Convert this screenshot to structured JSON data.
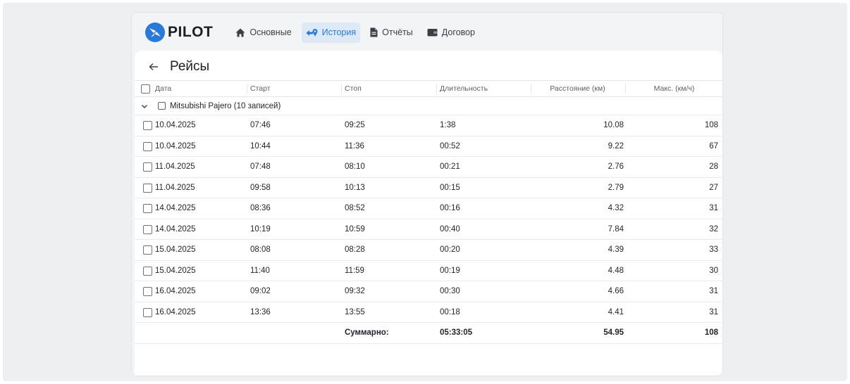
{
  "brand": {
    "name": "PILOT",
    "accent": "#2979d8"
  },
  "nav": [
    {
      "label": "Основные",
      "icon": "home-icon",
      "active": false
    },
    {
      "label": "История",
      "icon": "route-icon",
      "active": true
    },
    {
      "label": "Отчёты",
      "icon": "document-icon",
      "active": false
    },
    {
      "label": "Договор",
      "icon": "wallet-icon",
      "active": false
    }
  ],
  "page": {
    "title": "Рейсы"
  },
  "table": {
    "headers": {
      "date": "Дата",
      "start": "Старт",
      "stop": "Стоп",
      "duration": "Длительность",
      "distance": "Расстояние (км)",
      "max_speed": "Макс. (км/ч)"
    },
    "group": {
      "label": "Mitsubishi Pajero (10 записей)",
      "expanded": true
    },
    "rows": [
      {
        "date": "10.04.2025",
        "start": "07:46",
        "stop": "09:25",
        "duration": "1:38",
        "distance": "10.08",
        "max_speed": "108"
      },
      {
        "date": "10.04.2025",
        "start": "10:44",
        "stop": "11:36",
        "duration": "00:52",
        "distance": "9.22",
        "max_speed": "67"
      },
      {
        "date": "11.04.2025",
        "start": "07:48",
        "stop": "08:10",
        "duration": "00:21",
        "distance": "2.76",
        "max_speed": "28"
      },
      {
        "date": "11.04.2025",
        "start": "09:58",
        "stop": "10:13",
        "duration": "00:15",
        "distance": "2.79",
        "max_speed": "27"
      },
      {
        "date": "14.04.2025",
        "start": "08:36",
        "stop": "08:52",
        "duration": "00:16",
        "distance": "4.32",
        "max_speed": "31"
      },
      {
        "date": "14.04.2025",
        "start": "10:19",
        "stop": "10:59",
        "duration": "00:40",
        "distance": "7.84",
        "max_speed": "32"
      },
      {
        "date": "15.04.2025",
        "start": "08:08",
        "stop": "08:28",
        "duration": "00:20",
        "distance": "4.39",
        "max_speed": "33"
      },
      {
        "date": "15.04.2025",
        "start": "11:40",
        "stop": "11:59",
        "duration": "00:19",
        "distance": "4.48",
        "max_speed": "30"
      },
      {
        "date": "16.04.2025",
        "start": "09:02",
        "stop": "09:32",
        "duration": "00:30",
        "distance": "4.66",
        "max_speed": "31"
      },
      {
        "date": "16.04.2025",
        "start": "13:36",
        "stop": "13:55",
        "duration": "00:18",
        "distance": "4.41",
        "max_speed": "31"
      }
    ],
    "totals": {
      "label": "Суммарно:",
      "duration": "05:33:05",
      "distance": "54.95",
      "max_speed": "108"
    }
  }
}
